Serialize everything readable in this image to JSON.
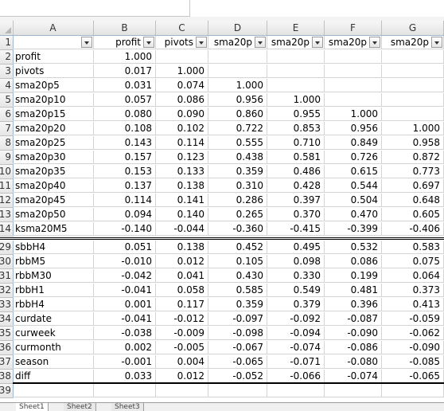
{
  "column_headers": [
    "A",
    "B",
    "C",
    "D",
    "E",
    "F",
    "G"
  ],
  "header_row": {
    "row_number": "1",
    "cells": [
      "",
      "profit",
      "pivots",
      "sma20p",
      "sma20p",
      "sma20p",
      "sma20p"
    ]
  },
  "rows": [
    {
      "n": "2",
      "label": "profit",
      "v": [
        "1.000",
        "",
        "",
        "",
        "",
        ""
      ]
    },
    {
      "n": "3",
      "label": "pivots",
      "v": [
        "0.017",
        "1.000",
        "",
        "",
        "",
        ""
      ]
    },
    {
      "n": "4",
      "label": "sma20p5",
      "v": [
        "0.031",
        "0.074",
        "1.000",
        "",
        "",
        ""
      ]
    },
    {
      "n": "5",
      "label": "sma20p10",
      "v": [
        "0.057",
        "0.086",
        "0.956",
        "1.000",
        "",
        ""
      ]
    },
    {
      "n": "6",
      "label": "sma20p15",
      "v": [
        "0.080",
        "0.090",
        "0.860",
        "0.955",
        "1.000",
        ""
      ]
    },
    {
      "n": "7",
      "label": "sma20p20",
      "v": [
        "0.108",
        "0.102",
        "0.722",
        "0.853",
        "0.956",
        "1.000"
      ]
    },
    {
      "n": "8",
      "label": "sma20p25",
      "v": [
        "0.143",
        "0.114",
        "0.555",
        "0.710",
        "0.849",
        "0.958"
      ]
    },
    {
      "n": "9",
      "label": "sma20p30",
      "v": [
        "0.157",
        "0.123",
        "0.438",
        "0.581",
        "0.726",
        "0.872"
      ]
    },
    {
      "n": "10",
      "label": "sma20p35",
      "v": [
        "0.153",
        "0.133",
        "0.359",
        "0.486",
        "0.615",
        "0.773"
      ]
    },
    {
      "n": "11",
      "label": "sma20p40",
      "v": [
        "0.137",
        "0.138",
        "0.310",
        "0.428",
        "0.544",
        "0.697"
      ]
    },
    {
      "n": "12",
      "label": "sma20p45",
      "v": [
        "0.114",
        "0.141",
        "0.286",
        "0.397",
        "0.504",
        "0.648"
      ]
    },
    {
      "n": "13",
      "label": "sma20p50",
      "v": [
        "0.094",
        "0.140",
        "0.265",
        "0.370",
        "0.470",
        "0.605"
      ]
    },
    {
      "n": "14",
      "label": "ksma20M5",
      "v": [
        "-0.140",
        "-0.044",
        "-0.360",
        "-0.415",
        "-0.399",
        "-0.406"
      ]
    },
    {
      "n": "29",
      "label": "sbbH4",
      "v": [
        "0.051",
        "0.138",
        "0.452",
        "0.495",
        "0.532",
        "0.583"
      ]
    },
    {
      "n": "30",
      "label": "rbbM5",
      "v": [
        "-0.010",
        "0.012",
        "0.105",
        "0.098",
        "0.086",
        "0.075"
      ]
    },
    {
      "n": "31",
      "label": "rbbM30",
      "v": [
        "-0.042",
        "0.041",
        "0.430",
        "0.330",
        "0.199",
        "0.064"
      ]
    },
    {
      "n": "32",
      "label": "rbbH1",
      "v": [
        "-0.041",
        "0.058",
        "0.585",
        "0.549",
        "0.481",
        "0.373"
      ]
    },
    {
      "n": "33",
      "label": "rbbH4",
      "v": [
        "0.001",
        "0.117",
        "0.359",
        "0.379",
        "0.396",
        "0.413"
      ]
    },
    {
      "n": "34",
      "label": "curdate",
      "v": [
        "-0.041",
        "-0.012",
        "-0.097",
        "-0.092",
        "-0.087",
        "-0.059"
      ]
    },
    {
      "n": "35",
      "label": "curweek",
      "v": [
        "-0.038",
        "-0.009",
        "-0.098",
        "-0.094",
        "-0.090",
        "-0.062"
      ]
    },
    {
      "n": "36",
      "label": "curmonth",
      "v": [
        "0.002",
        "-0.005",
        "-0.067",
        "-0.074",
        "-0.086",
        "-0.090"
      ]
    },
    {
      "n": "37",
      "label": "season",
      "v": [
        "-0.001",
        "0.004",
        "-0.065",
        "-0.071",
        "-0.080",
        "-0.085"
      ]
    },
    {
      "n": "38",
      "label": "diff",
      "v": [
        "0.033",
        "0.012",
        "-0.052",
        "-0.066",
        "-0.074",
        "-0.065"
      ]
    },
    {
      "n": "39",
      "label": "",
      "v": [
        "",
        "",
        "",
        "",
        "",
        ""
      ]
    }
  ],
  "sheet_tabs": [
    "Sheet1",
    "Sheet2",
    "Sheet3"
  ]
}
